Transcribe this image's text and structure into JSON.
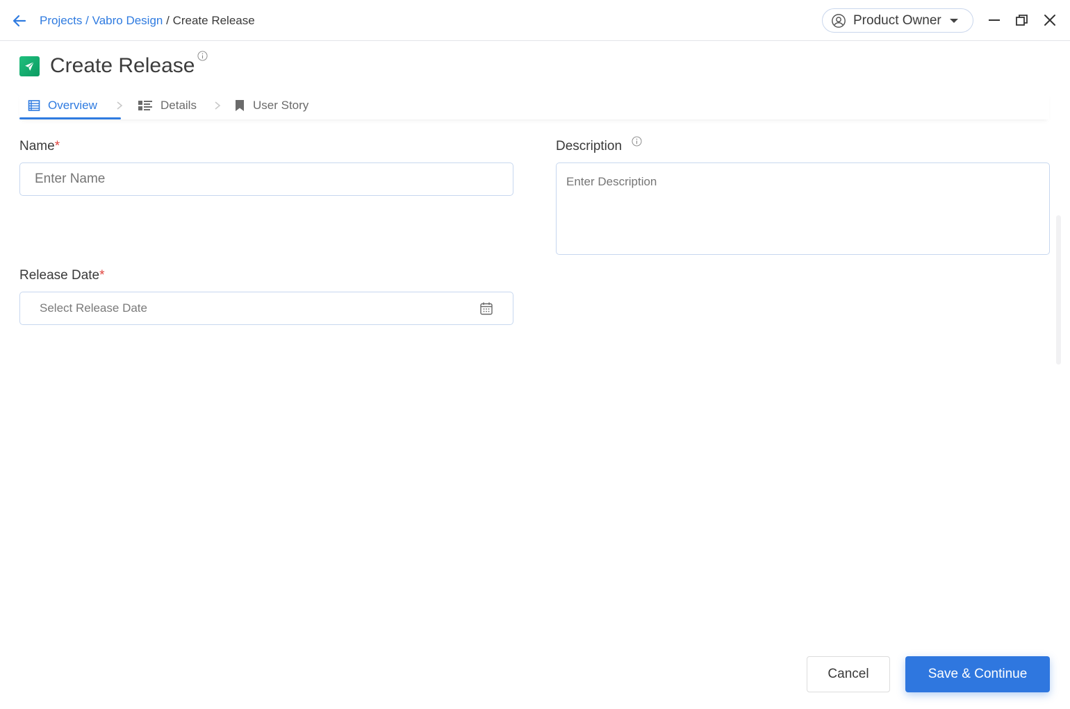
{
  "header": {
    "breadcrumb": {
      "items": [
        "Projects",
        "Vabro Design"
      ],
      "separator": "/",
      "current": "Create Release"
    },
    "role_selector": {
      "label": "Product Owner",
      "icon": "user-circle-icon"
    },
    "window_controls": [
      "minimize-icon",
      "restore-icon",
      "close-icon"
    ]
  },
  "page": {
    "title": "Create Release",
    "title_icon": "paper-plane-icon",
    "accent_color": "#2f7be0",
    "brand_icon_color": "#1aae72"
  },
  "tabs": [
    {
      "label": "Overview",
      "icon": "list-icon",
      "active": true
    },
    {
      "label": "Details",
      "icon": "details-list-icon",
      "active": false
    },
    {
      "label": "User Story",
      "icon": "bookmark-icon",
      "active": false
    }
  ],
  "form": {
    "name": {
      "label": "Name",
      "required_mark": "*",
      "placeholder": "Enter Name",
      "value": ""
    },
    "description": {
      "label": "Description",
      "placeholder": "Enter Description",
      "value": ""
    },
    "release_date": {
      "label": "Release Date",
      "required_mark": "*",
      "placeholder": "Select Release Date",
      "icon": "calendar-icon"
    }
  },
  "footer": {
    "cancel_label": "Cancel",
    "save_label": "Save & Continue",
    "save_color": "#2f77df"
  }
}
